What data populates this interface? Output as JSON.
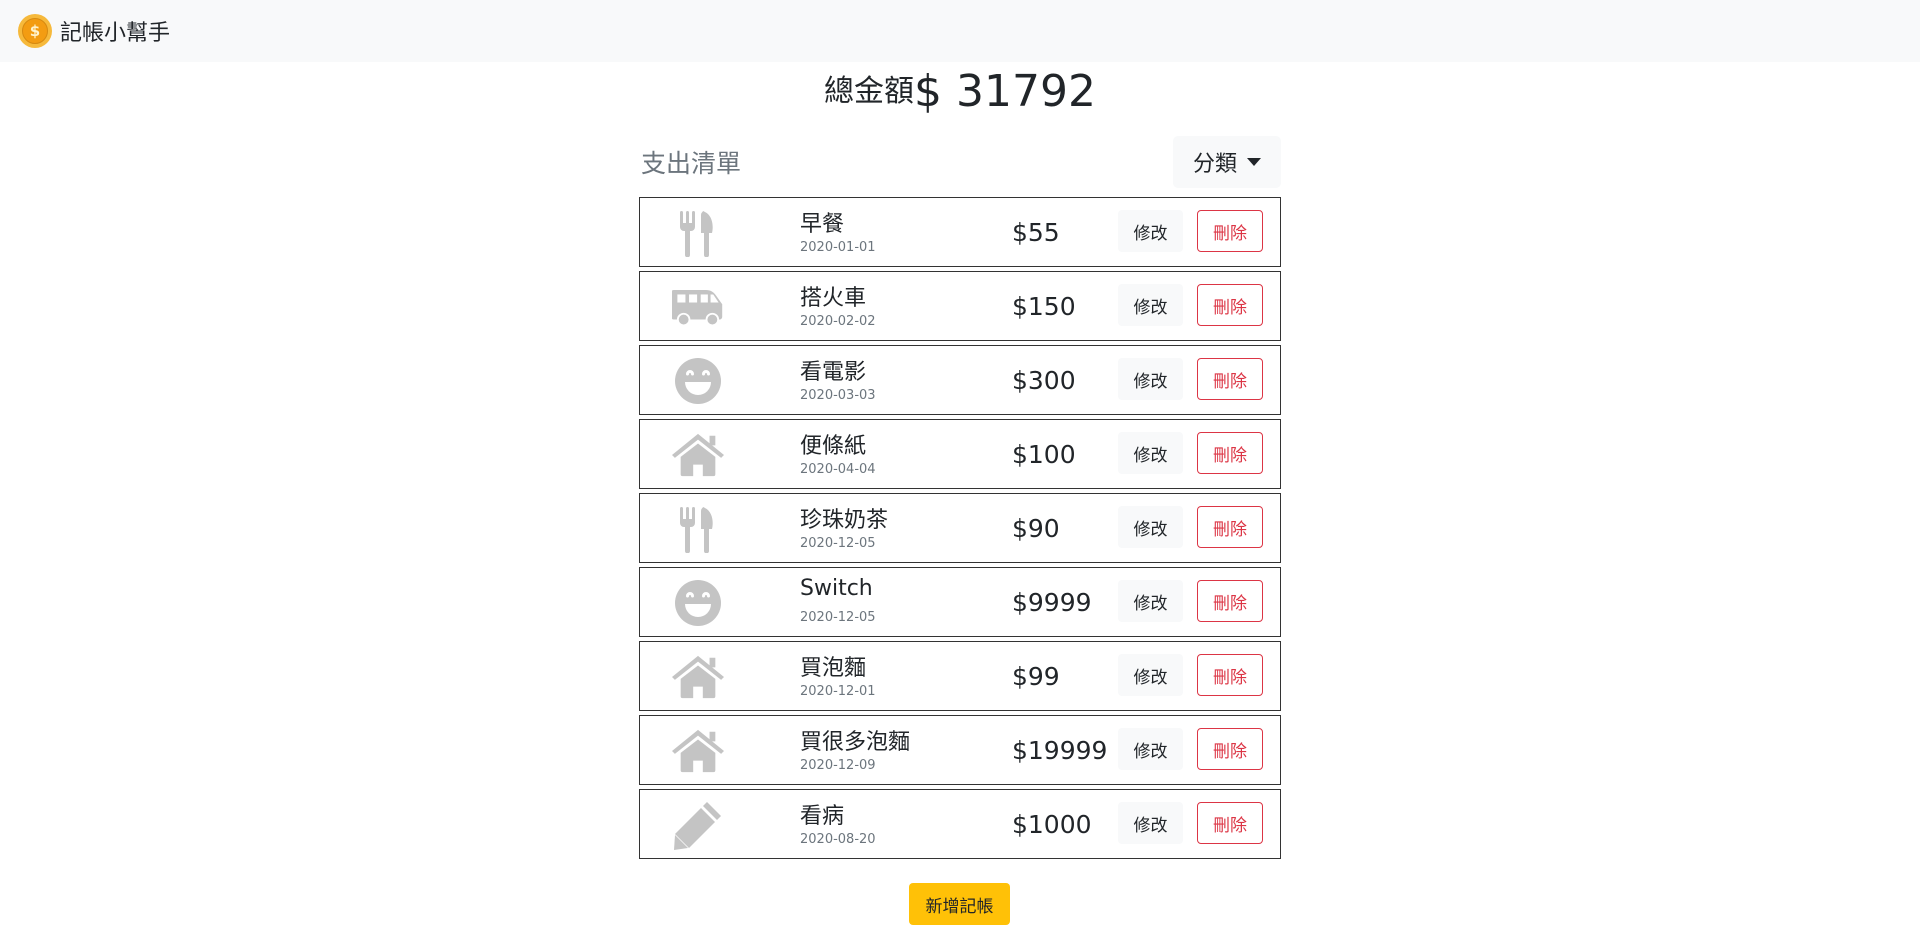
{
  "app": {
    "title": "記帳小幫手",
    "logo_icon": "coin-icon",
    "logo_symbol": "$"
  },
  "total": {
    "label": "總金額",
    "amount": "$ 31792"
  },
  "list": {
    "title": "支出清單",
    "category_button": "分類"
  },
  "records": [
    {
      "icon": "utensils-icon",
      "name": "早餐",
      "date": "2020-01-01",
      "amount": "$55",
      "edit": "修改",
      "delete": "刪除"
    },
    {
      "icon": "van-icon",
      "name": "搭火車",
      "date": "2020-02-02",
      "amount": "$150",
      "edit": "修改",
      "delete": "刪除"
    },
    {
      "icon": "smile-icon",
      "name": "看電影",
      "date": "2020-03-03",
      "amount": "$300",
      "edit": "修改",
      "delete": "刪除"
    },
    {
      "icon": "home-icon",
      "name": "便條紙",
      "date": "2020-04-04",
      "amount": "$100",
      "edit": "修改",
      "delete": "刪除"
    },
    {
      "icon": "utensils-icon",
      "name": "珍珠奶茶",
      "date": "2020-12-05",
      "amount": "$90",
      "edit": "修改",
      "delete": "刪除"
    },
    {
      "icon": "smile-icon",
      "name": "Switch",
      "date": "2020-12-05",
      "amount": "$9999",
      "edit": "修改",
      "delete": "刪除"
    },
    {
      "icon": "home-icon",
      "name": "買泡麵",
      "date": "2020-12-01",
      "amount": "$99",
      "edit": "修改",
      "delete": "刪除"
    },
    {
      "icon": "home-icon",
      "name": "買很多泡麵",
      "date": "2020-12-09",
      "amount": "$19999",
      "edit": "修改",
      "delete": "刪除"
    },
    {
      "icon": "pencil-icon",
      "name": "看病",
      "date": "2020-08-20",
      "amount": "$1000",
      "edit": "修改",
      "delete": "刪除"
    }
  ],
  "add_button": "新增記帳",
  "colors": {
    "navbar_bg": "#f8f9fa",
    "icon_gray": "#c4c4c4",
    "danger": "#dc3545",
    "warning": "#ffc107"
  }
}
